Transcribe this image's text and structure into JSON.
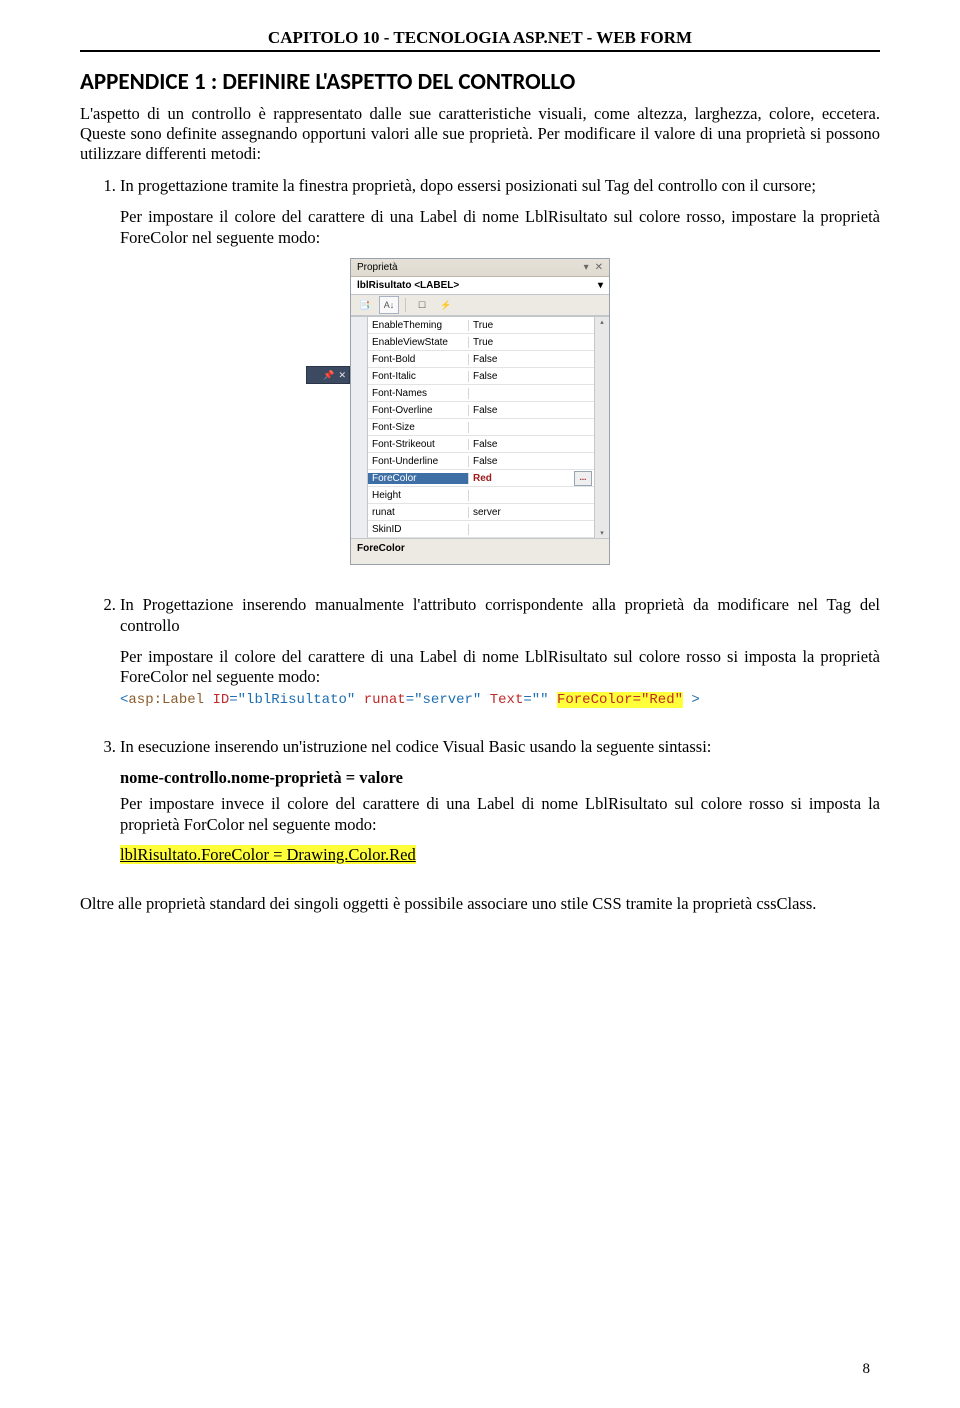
{
  "header": {
    "chapter": "CAPITOLO 10 -  TECNOLOGIA ASP.NET -  WEB FORM"
  },
  "appendix": {
    "title": "APPENDICE 1 : DEFINIRE L'ASPETTO DEL CONTROLLO"
  },
  "intro": {
    "p1": "L'aspetto di un controllo è rappresentato dalle sue caratteristiche visuali, come altezza, larghezza, colore, eccetera. Queste sono definite assegnando opportuni valori alle sue proprietà. Per modificare il valore di una proprietà si possono utilizzare differenti metodi:"
  },
  "item1": {
    "text": "In progettazione tramite la finestra proprietà, dopo essersi posizionati sul Tag del controllo con il cursore;",
    "example": "Per impostare il colore del carattere di una Label di nome LblRisultato sul colore rosso, impostare la proprietà ForeColor nel seguente modo:"
  },
  "panel": {
    "title": "Proprietà",
    "pin": "▾",
    "dock": "✕",
    "object": "lblRisultato <LABEL>",
    "dropdown": "▾",
    "toolbar": {
      "cat": "📑",
      "az": "A↓",
      "sep": "|",
      "prop": "☐",
      "ev": "⚡"
    },
    "rows": [
      {
        "name": "EnableTheming",
        "value": "True"
      },
      {
        "name": "EnableViewState",
        "value": "True"
      },
      {
        "name": "Font-Bold",
        "value": "False"
      },
      {
        "name": "Font-Italic",
        "value": "False"
      },
      {
        "name": "Font-Names",
        "value": ""
      },
      {
        "name": "Font-Overline",
        "value": "False"
      },
      {
        "name": "Font-Size",
        "value": ""
      },
      {
        "name": "Font-Strikeout",
        "value": "False"
      },
      {
        "name": "Font-Underline",
        "value": "False"
      },
      {
        "name": "ForeColor",
        "value": "Red",
        "selected": true
      },
      {
        "name": "Height",
        "value": ""
      },
      {
        "name": "runat",
        "value": "server"
      },
      {
        "name": "SkinID",
        "value": ""
      }
    ],
    "help": "ForeColor",
    "scroll": {
      "up": "▴",
      "down": "▾"
    },
    "ellipsis": "..."
  },
  "item2": {
    "text": "In Progettazione inserendo manualmente l'attributo corrispondente alla proprietà da modificare nel Tag del controllo",
    "example": "Per impostare il colore del carattere di una Label di nome LblRisultato sul colore rosso si imposta la proprietà ForeColor nel seguente modo:",
    "code": {
      "lt": "<",
      "tag": "asp:Label",
      "sp": " ",
      "attrId": "ID",
      "eq": "=",
      "valId": "\"lblRisultato\"",
      "attrRunat": "runat",
      "valRunat": "\"server\"",
      "attrText": "Text",
      "valText": "\"\"",
      "foreAttr": "ForeColor",
      "foreEq": "=",
      "foreVal": "\"Red\"",
      "gt": " >"
    }
  },
  "item3": {
    "text": "In esecuzione inserendo un'istruzione nel codice Visual Basic usando la seguente sintassi:",
    "syntax": "nome-controllo.nome-proprietà = valore",
    "example": "Per impostare invece il colore del carattere di una Label di nome LblRisultato sul colore rosso si imposta la proprietà ForColor nel seguente modo:",
    "code": "lblRisultato.ForeColor = Drawing.Color.Red"
  },
  "closing": {
    "text": "Oltre alle proprietà standard dei singoli oggetti è possibile associare uno stile CSS tramite la proprietà cssClass."
  },
  "page": {
    "number": "8"
  },
  "mini": {
    "pin": "📌",
    "x": "✕"
  }
}
